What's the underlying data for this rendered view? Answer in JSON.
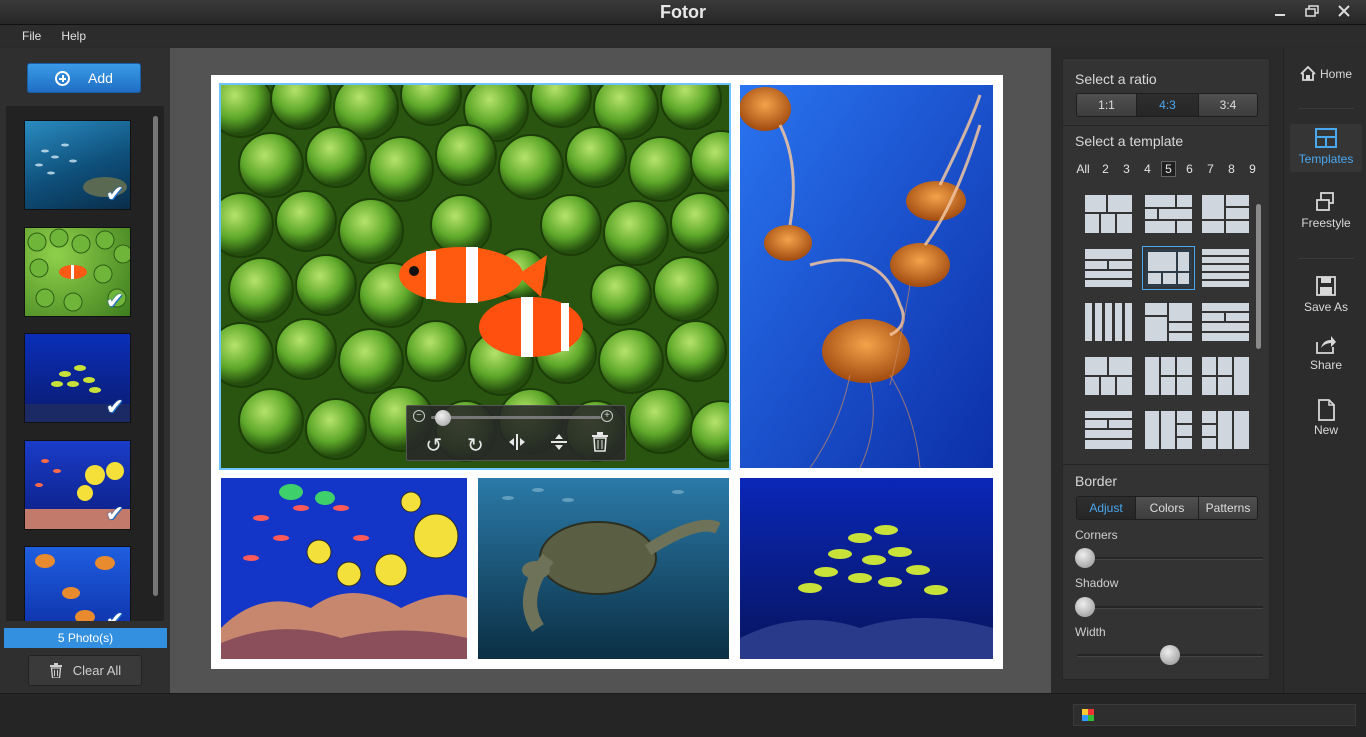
{
  "app": {
    "title": "Fotor"
  },
  "window_buttons": [
    "minimize",
    "restore",
    "close"
  ],
  "menu": {
    "items": [
      "File",
      "Help"
    ]
  },
  "left": {
    "add_label": "Add",
    "photo_count": "5 Photo(s)",
    "clear_label": "Clear All",
    "thumbnails": [
      {
        "subject": "fish-school-turtle",
        "checked": true
      },
      {
        "subject": "clownfish-anemone",
        "checked": true
      },
      {
        "subject": "fish-school-reef",
        "checked": true
      },
      {
        "subject": "yellow-tang-reef",
        "checked": true
      },
      {
        "subject": "jellyfish",
        "checked": true
      }
    ]
  },
  "canvas": {
    "cells": [
      {
        "subject": "clownfish-anemone",
        "selected": true
      },
      {
        "subject": "jellyfish",
        "selected": false
      },
      {
        "subject": "yellow-tang-reef",
        "selected": false
      },
      {
        "subject": "sea-turtle",
        "selected": false
      },
      {
        "subject": "fish-school-reef",
        "selected": false
      }
    ],
    "toolbar": {
      "zoom_out": "−",
      "zoom_in": "+",
      "tools": [
        "rotate-left-icon",
        "rotate-right-icon",
        "flip-horizontal-icon",
        "flip-vertical-icon",
        "trash-icon"
      ]
    }
  },
  "right_panel": {
    "ratio_heading": "Select a ratio",
    "ratios": [
      "1:1",
      "4:3",
      "3:4"
    ],
    "ratio_selected": "4:3",
    "template_heading": "Select a template",
    "template_counts": [
      "All",
      "2",
      "3",
      "4",
      "5",
      "6",
      "7",
      "8",
      "9"
    ],
    "template_count_selected": "5",
    "border_heading": "Border",
    "border_tabs": [
      "Adjust",
      "Colors",
      "Patterns"
    ],
    "border_tab_selected": "Adjust",
    "sliders": [
      {
        "label": "Corners",
        "value": 0.0
      },
      {
        "label": "Shadow",
        "value": 0.0
      },
      {
        "label": "Width",
        "value": 0.5
      }
    ]
  },
  "right_bar": {
    "home": "Home",
    "templates": "Templates",
    "freestyle": "Freestyle",
    "save_as": "Save As",
    "share": "Share",
    "new": "New"
  },
  "colors": {
    "accent": "#3390e0",
    "selected_outline": "#6fc3ff",
    "active_text": "#4aa8f0"
  }
}
